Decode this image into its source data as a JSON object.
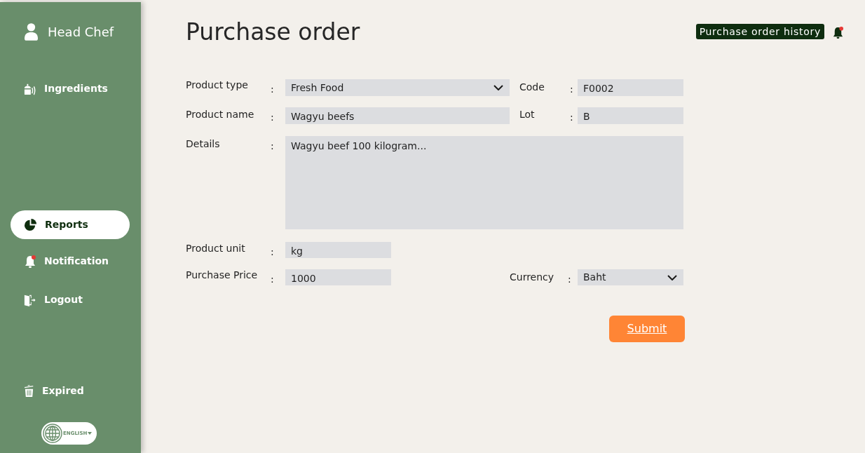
{
  "sidebar": {
    "user": {
      "name": "Head Chef"
    },
    "items": [
      {
        "label": "Ingredients",
        "selected": false,
        "alert": false
      },
      {
        "label": "Reports",
        "selected": true,
        "alert": false
      },
      {
        "label": "Notification",
        "selected": false,
        "alert": true
      },
      {
        "label": "Logout",
        "selected": false,
        "alert": false
      }
    ],
    "bottom_items": [
      {
        "label": "Expired",
        "selected": false,
        "alert": false
      }
    ],
    "language": {
      "label": "ENGLISH"
    }
  },
  "header": {
    "title": "Purchase order",
    "history_button": "Purchase order history",
    "notification_alert": true
  },
  "form": {
    "product_type": {
      "label": "Product type",
      "separator": ":",
      "kind": "select",
      "value": "Fresh Food"
    },
    "code": {
      "label": "Code",
      "separator": ":",
      "kind": "text",
      "value": "F0002"
    },
    "product_name": {
      "label": "Product name",
      "separator": ":",
      "kind": "text",
      "value": "Wagyu beefs"
    },
    "lot": {
      "label": "Lot",
      "separator": ":",
      "kind": "text",
      "value": "B"
    },
    "details": {
      "label": "Details",
      "separator": ":",
      "kind": "textarea",
      "value": "Wagyu beef 100 kilogram..."
    },
    "product_unit": {
      "label": "Product unit",
      "separator": ":",
      "kind": "text",
      "value": "kg"
    },
    "purchase_price": {
      "label": "Purchase Price",
      "separator": ":",
      "kind": "text",
      "value": "1000"
    },
    "currency": {
      "label": "Currency",
      "separator": ":",
      "kind": "select",
      "value": "Baht"
    },
    "submit": "Submit"
  }
}
